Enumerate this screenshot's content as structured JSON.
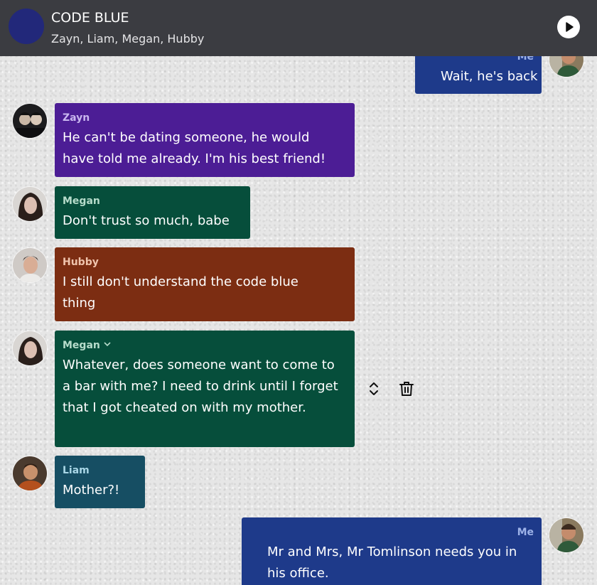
{
  "header": {
    "title": "CODE BLUE",
    "members": "Zayn, Liam, Megan, Hubby",
    "group_avatar_color": "#22287a",
    "play_icon": "play-circle-icon"
  },
  "colors": {
    "me": "#1e3a8a",
    "zayn": "#4c1d95",
    "megan": "#064e3b",
    "hubby": "#7c2d12",
    "liam": "#164e63"
  },
  "messages": [
    {
      "sender": "Me",
      "text": "Wait, he's back"
    },
    {
      "sender": "Zayn",
      "text": "He can't be dating someone, he would have told me already. I'm his best friend!"
    },
    {
      "sender": "Megan",
      "text": "Don't trust so much, babe"
    },
    {
      "sender": "Hubby",
      "text": "I still don't understand the code blue thing"
    },
    {
      "sender": "Megan",
      "text": "Whatever, does someone want to come to a bar with me? I need to drink until I forget that I got cheated on with my mother."
    },
    {
      "sender": "Liam",
      "text": "Mother?!"
    },
    {
      "sender": "Me",
      "text": "Mr and Mrs, Mr Tomlinson needs you in his office."
    }
  ],
  "message_tools": {
    "reorder_icon": "chevron-up-down-icon",
    "delete_icon": "trash-icon"
  }
}
